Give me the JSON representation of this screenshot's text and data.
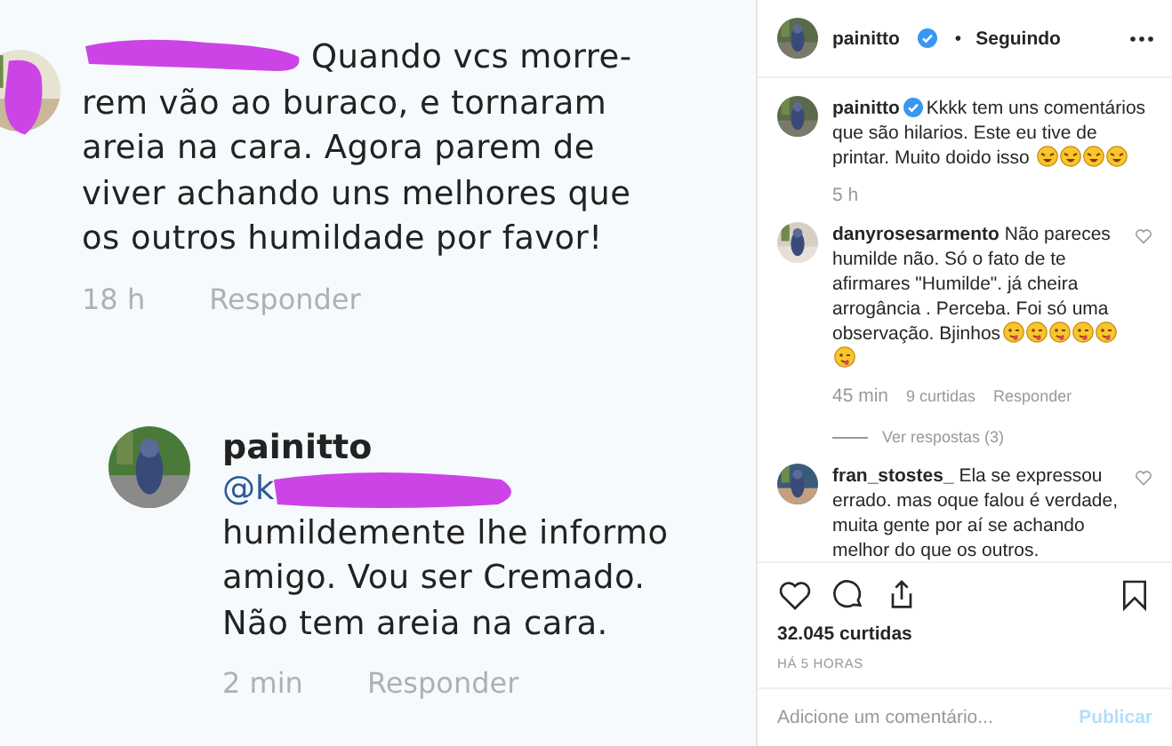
{
  "post_image": {
    "comments": [
      {
        "username_redacted": true,
        "text": "Quando vcs morre-rem  vão ao buraco, e tornaram areia na cara. Agora parem de viver achando uns melhores que os outros humildade por favor!",
        "time": "18 h",
        "reply": "Responder"
      },
      {
        "username": "painitto",
        "mention": "@k",
        "text": "humildemente lhe informo amigo. Vou ser Cremado. Não tem areia na cara.",
        "time": "2 min",
        "reply": "Responder"
      }
    ]
  },
  "header": {
    "username": "painitto",
    "verified": true,
    "separator": "•",
    "follow_status": "Seguindo"
  },
  "caption": {
    "username": "painitto",
    "verified": true,
    "text": "Kkkk tem uns comentários que são hilarios. Este eu tive de printar. Muito doido isso",
    "emojis": [
      {
        "kind": "laughing"
      },
      {
        "kind": "laughing"
      },
      {
        "kind": "laughing"
      },
      {
        "kind": "laughing"
      }
    ],
    "time": "5 h"
  },
  "comments": [
    {
      "username": "danyrosesarmento",
      "text": "Não pareces humilde não. Só o fato de te afirmares \"Humilde\". já cheira arrogância . Perceba. Foi só uma observação. Bjinhos",
      "emojis": [
        {
          "kind": "tongue"
        },
        {
          "kind": "tongue"
        },
        {
          "kind": "tongue"
        },
        {
          "kind": "tongue"
        },
        {
          "kind": "tongue"
        },
        {
          "kind": "tongue"
        }
      ],
      "time": "45 min",
      "likes": "9 curtidas",
      "reply": "Responder",
      "replies_link": "Ver respostas (3)",
      "liked": false
    },
    {
      "username": "fran_stostes_",
      "text": "Ela se expressou errado. mas oque falou é verdade, muita gente por aí se achando melhor do que os outros.",
      "liked": false
    }
  ],
  "likes": "32.045 curtidas",
  "posted": "HÁ 5 HORAS",
  "saved": false,
  "comment_box": {
    "placeholder": "Adicione um comentário...",
    "button": "Publicar"
  }
}
